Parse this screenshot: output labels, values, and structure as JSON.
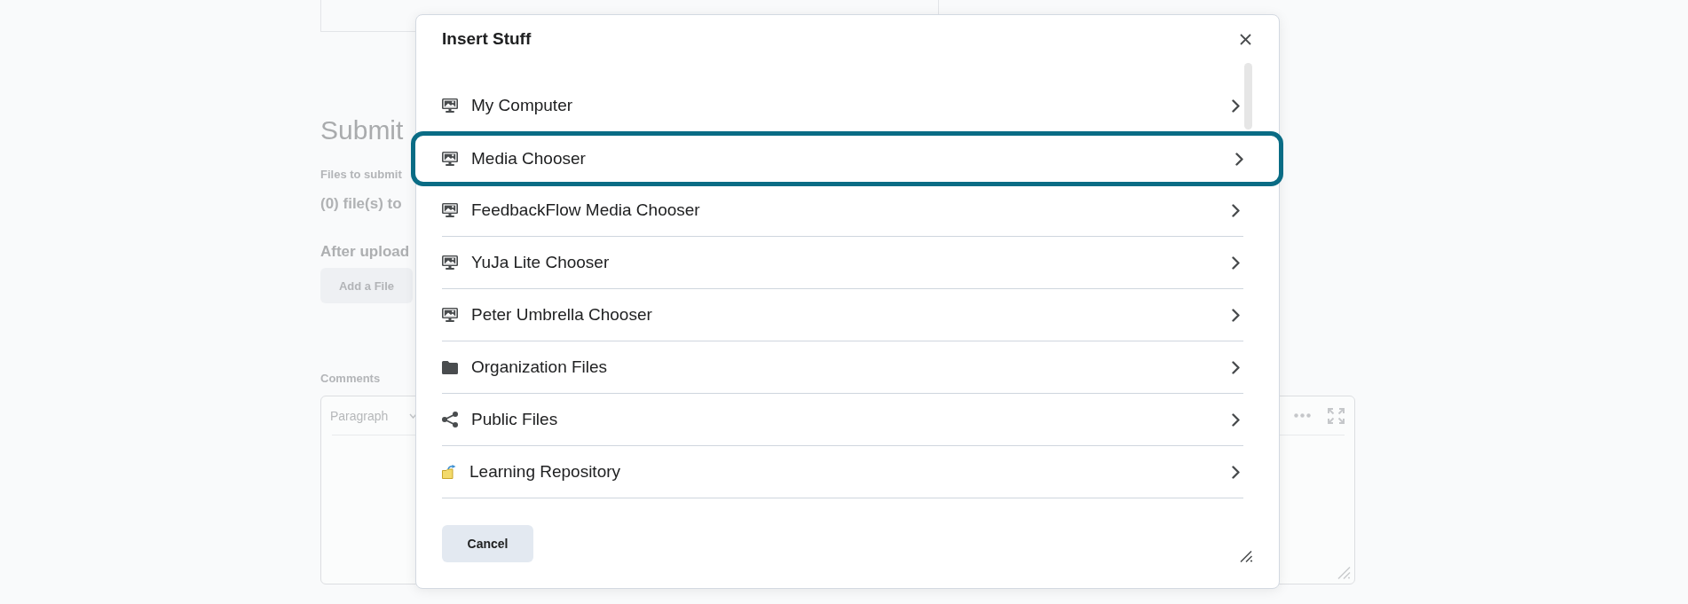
{
  "background_page": {
    "heading": "Submit",
    "files_label": "Files to submit",
    "file_count": "(0) file(s) to",
    "after_upload_heading": "After upload",
    "add_file_button": "Add a File",
    "comments_label": "Comments",
    "editor": {
      "format_dropdown": "Paragraph"
    }
  },
  "dialog": {
    "title": "Insert Stuff",
    "items": [
      {
        "label": "My Computer",
        "kind": "media",
        "selected": false
      },
      {
        "label": "Media Chooser",
        "kind": "media",
        "selected": true
      },
      {
        "label": "FeedbackFlow Media Chooser",
        "kind": "media",
        "selected": false
      },
      {
        "label": "YuJa Lite Chooser",
        "kind": "media",
        "selected": false
      },
      {
        "label": "Peter Umbrella Chooser",
        "kind": "media",
        "selected": false
      },
      {
        "label": "Organization Files",
        "kind": "files",
        "selected": false
      },
      {
        "label": "Public Files",
        "kind": "shared",
        "selected": false
      },
      {
        "label": "Learning Repository",
        "kind": "repository",
        "selected": false
      }
    ],
    "buttons": [
      "Cancel"
    ]
  }
}
